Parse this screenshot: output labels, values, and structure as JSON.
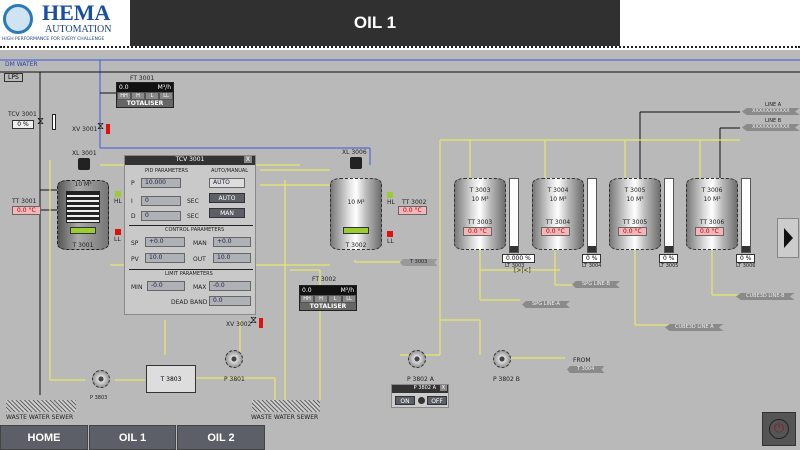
{
  "header": {
    "logo_name": "HEMA",
    "logo_sub": "AUTOMATION",
    "logo_tagline": "HIGH PERFORMANCE FOR EVERY CHALLENGE",
    "title": "OIL 1"
  },
  "pipes": {
    "dm_water": "DM WATER",
    "lps": "LPS"
  },
  "tcv": {
    "tag": "TCV 3001",
    "value": "0 %"
  },
  "xv3001": "XV 3001",
  "ft3001": {
    "tag": "FT 3001",
    "value": "0.0",
    "unit": "M³/h",
    "levels": [
      "HH",
      "H",
      "L",
      "LL"
    ],
    "label": "TOTALISER"
  },
  "ft3002": {
    "tag": "FT 3002",
    "value": "0.0",
    "unit": "M³/h",
    "levels": [
      "HH",
      "H",
      "L",
      "LL"
    ],
    "label": "TOTALISER"
  },
  "t3001": {
    "name": "T 3001",
    "cap": "10 M³",
    "agitator": "XL 3001",
    "temp_tag": "TT 3001",
    "temp": "0.0 °C",
    "hl": "HL",
    "ll": "LL"
  },
  "t3002": {
    "name": "T 3002",
    "cap": "10 M³",
    "agitator": "XL 3006",
    "temp_tag": "TT 3002",
    "temp": "0.0 °C",
    "hl": "HL",
    "ll": "LL",
    "line": "T 3003"
  },
  "dialog": {
    "title": "TCV 3001",
    "close": "X",
    "pid_title": "PID PARAMETERS",
    "am_title": "AUTO/MANUAL",
    "p_label": "P",
    "p": "10.000",
    "i_label": "I",
    "i": "0",
    "i_unit": "SEC",
    "d_label": "D",
    "d": "0",
    "d_unit": "SEC",
    "mode": "AUTO",
    "auto_btn": "AUTO",
    "man_btn": "MAN",
    "ctrl_title": "CONTROL PARAMETERS",
    "sp_label": "SP",
    "sp": "+0.0",
    "man_label": "MAN",
    "man": "+0.0",
    "pv_label": "PV",
    "pv": "10.0",
    "out_label": "OUT",
    "out": "10.0",
    "lim_title": "LIMIT PARAMETERS",
    "min_label": "MIN",
    "min": "-0.0",
    "max_label": "MAX",
    "max": "-0.0",
    "db_label": "DEAD BAND",
    "db": "0.0"
  },
  "xv3002": "XV 3002",
  "storage": [
    {
      "id": "T 3003",
      "cap": "10 M³",
      "tt": "TT 3003",
      "temp": "0.0 °C",
      "lt_value": "0.000 %",
      "lt": "LT 3003"
    },
    {
      "id": "T 3004",
      "cap": "10 M³",
      "tt": "TT 3004",
      "temp": "0.0 °C",
      "lt_value": "0 %",
      "lt": "LT 3004"
    },
    {
      "id": "T 3005",
      "cap": "10 M³",
      "tt": "TT 3005",
      "temp": "0.0 °C",
      "lt_value": "0 %",
      "lt": "LT 3005"
    },
    {
      "id": "T 3006",
      "cap": "10 M³",
      "tt": "TT 3006",
      "temp": "0.0 °C",
      "lt_value": "0 %",
      "lt": "LT 3006"
    }
  ],
  "scale": [
    "100",
    "80",
    "60",
    "40",
    "20",
    "0"
  ],
  "lines": {
    "line_a": "LINE A",
    "line_b": "LINE B",
    "line_a_tag": "XXXXXXXXXXX",
    "line_b_tag": "XXXXXXXXXXX",
    "spg_b": "SPG LINE-B",
    "spg_a": "SPG LINE-A",
    "cube_a": "CUBE3D LINE A",
    "cube_b": "CUBE3D LINE-B",
    "from": "FROM",
    "from_tag": "T 3004",
    "bypass": "[>|<]"
  },
  "pumps": {
    "p3803": "P 3803",
    "p3801": "P 3801",
    "p3802a": "P 3802 A",
    "p3802b": "P 3802 B",
    "t3803": "T 3803"
  },
  "pump_popup": {
    "title": "P 3802 A",
    "close": "X",
    "on": "ON",
    "off": "OFF"
  },
  "sewer": {
    "left": "WASTE WATER SEWER",
    "right": "WASTE WATER SEWER"
  },
  "nav": {
    "home": "HOME",
    "oil1": "OIL 1",
    "oil2": "OIL 2"
  },
  "colors": {
    "pipe_water": "#3a5bd9",
    "pipe_oil": "#e8e86a",
    "alarm_red": "#e01010",
    "ok_green": "#9acd32"
  }
}
